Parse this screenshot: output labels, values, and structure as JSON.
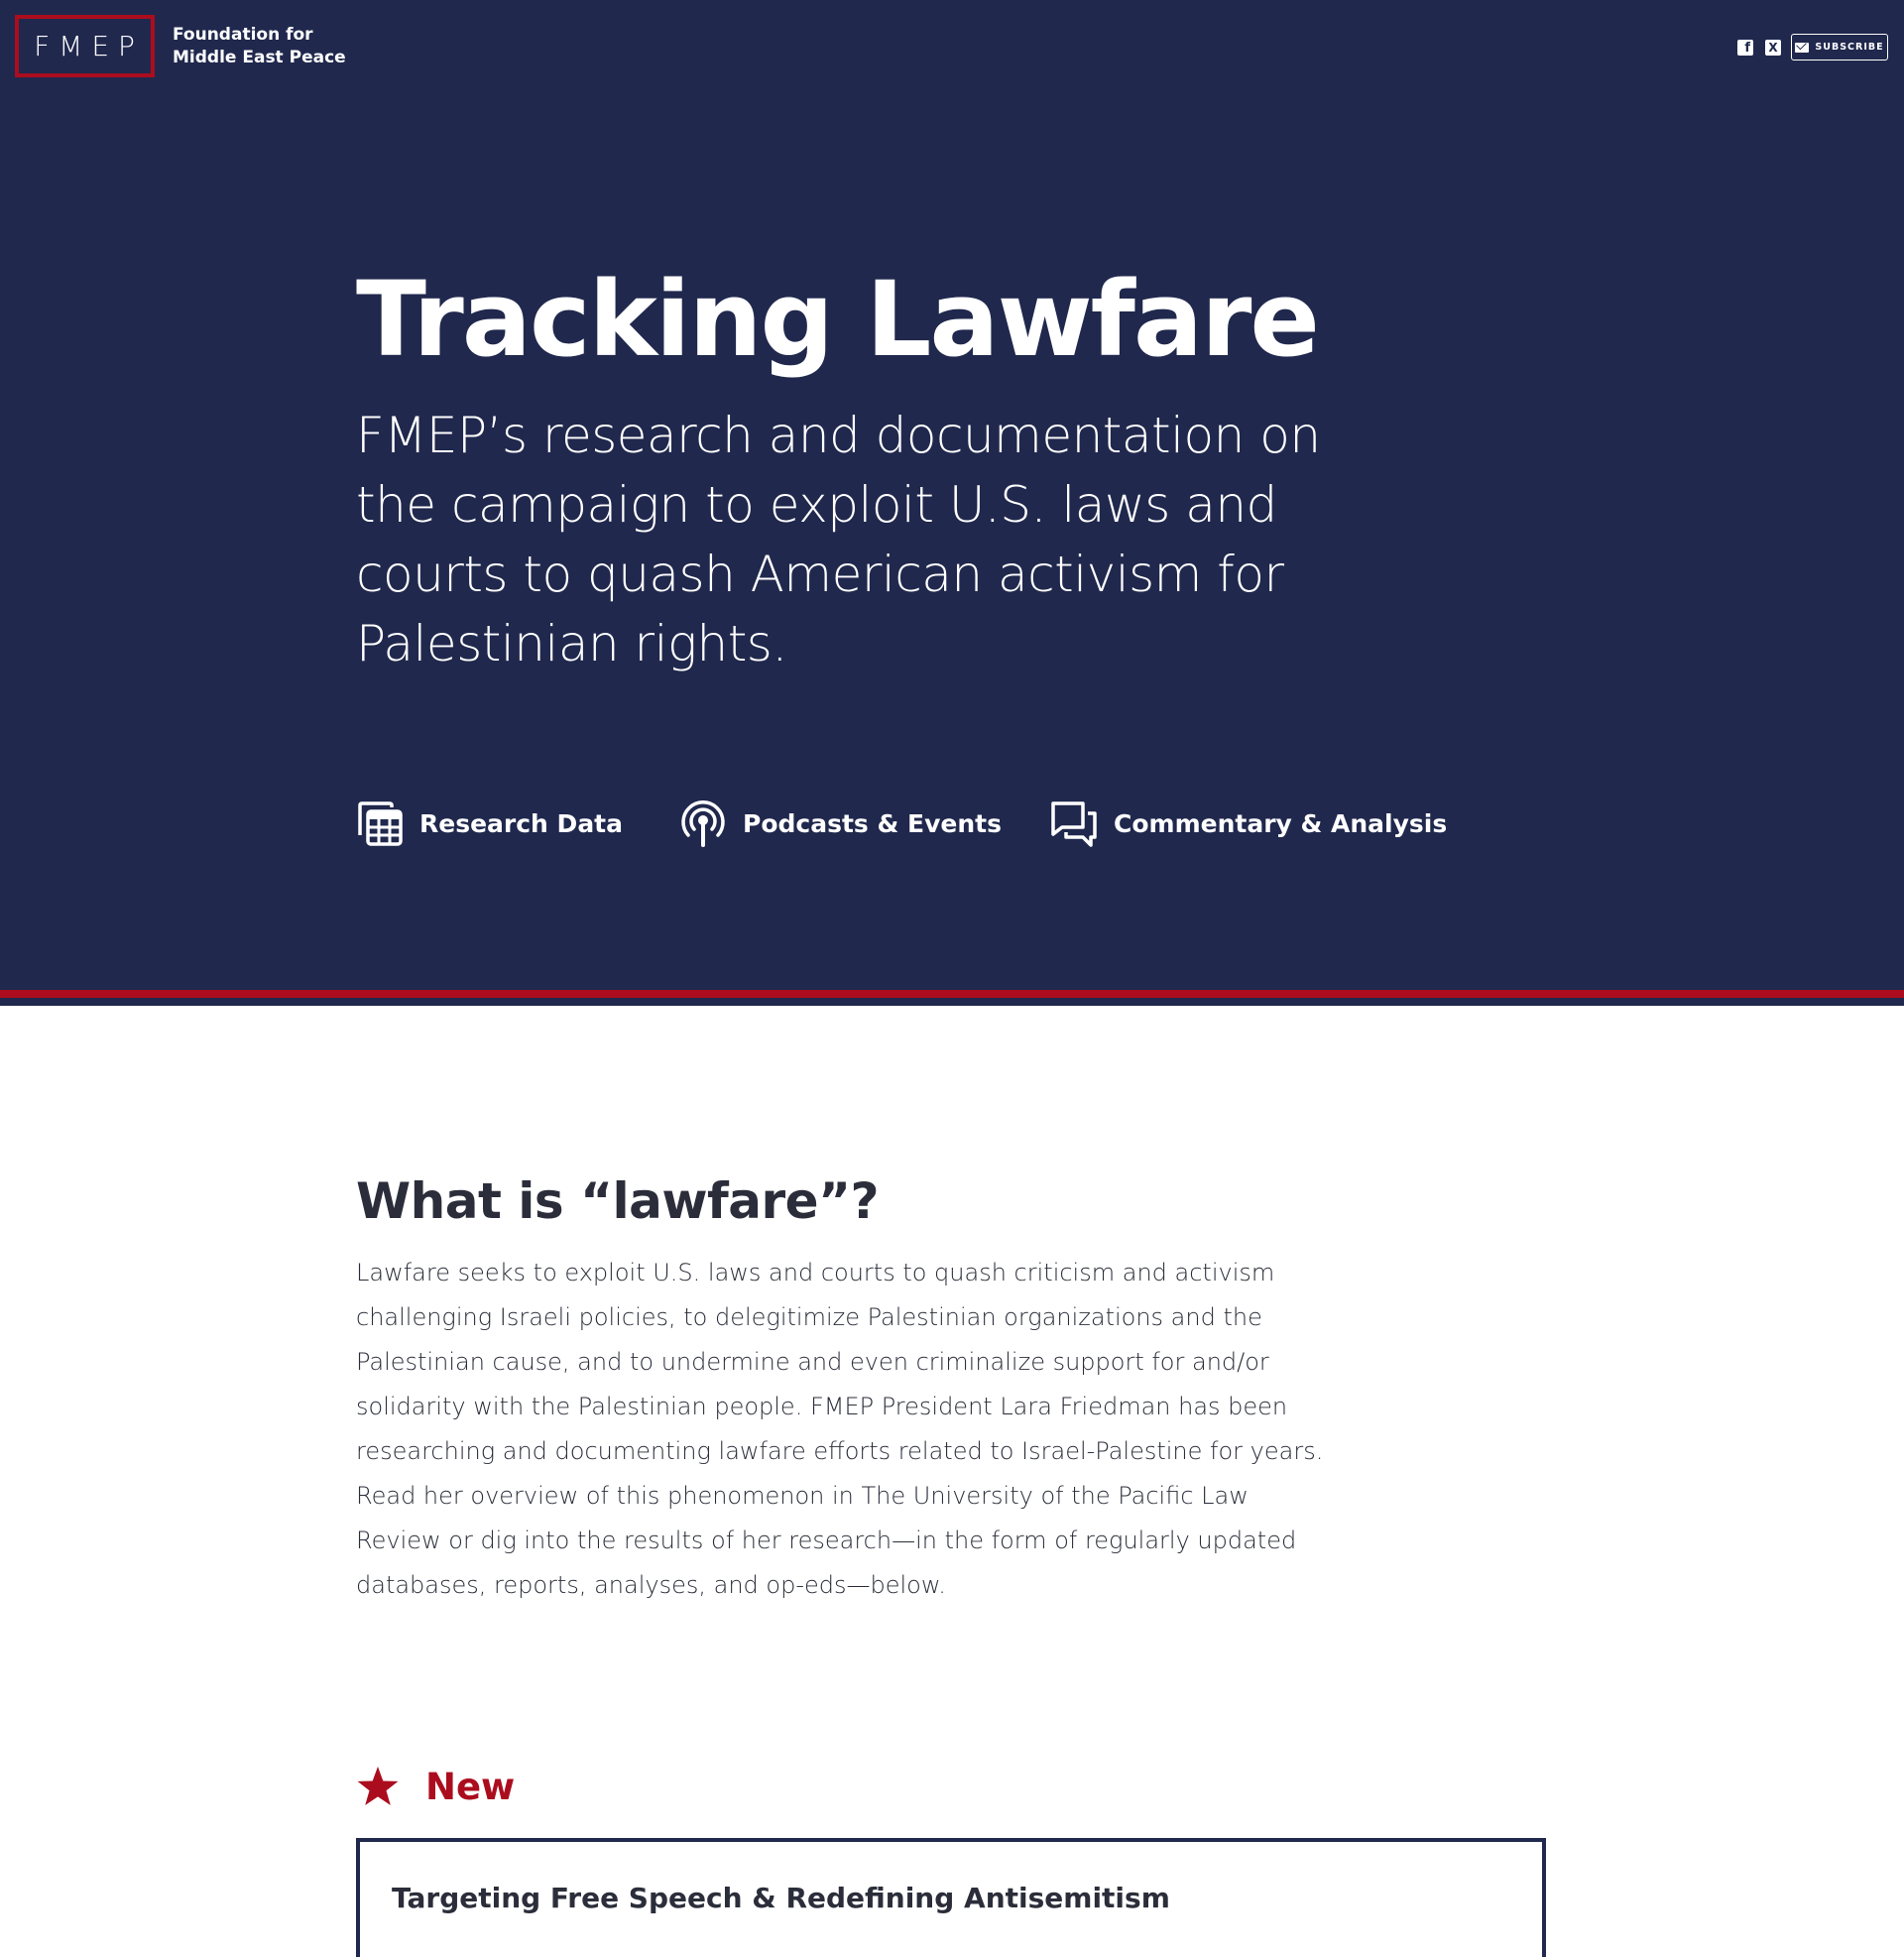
{
  "header": {
    "logo_text": "FMEP",
    "org_name_line1": "Foundation for",
    "org_name_line2": "Middle East Peace",
    "subscribe_label": "SUBSCRIBE",
    "facebook_glyph": "f",
    "x_glyph": "X"
  },
  "hero": {
    "title": "Tracking Lawfare",
    "subtitle": "FMEP’s research and documentation on the campaign to exploit U.S. laws and courts to quash American activism for Palestinian rights.",
    "links": [
      {
        "label": "Research Data",
        "icon": "spreadsheet-icon"
      },
      {
        "label": "Podcasts & Events",
        "icon": "podcast-icon"
      },
      {
        "label": "Commentary & Analysis",
        "icon": "chat-bubbles-icon"
      }
    ]
  },
  "about": {
    "title": "What is “lawfare”?",
    "body": "Lawfare seeks to exploit U.S. laws and courts to quash criticism and activism challenging Israeli policies, to delegitimize Palestinian organizations and the Palestinian cause, and to undermine and even criminalize support for and/or solidarity with the Palestinian people. FMEP President Lara Friedman has been researching and documenting lawfare efforts related to Israel-Palestine for years. Read her overview of this phenomenon in The University of the Pacific Law Review or dig into the results of her research—in the form of regularly updated databases, reports, analyses, and op-eds—below."
  },
  "new_section": {
    "label": "New",
    "card_title": "Targeting Free Speech & Redefining Antisemitism"
  },
  "colors": {
    "navy": "#20284d",
    "accent_red": "#ab0d1e",
    "text_dark": "#2b2e3a"
  }
}
